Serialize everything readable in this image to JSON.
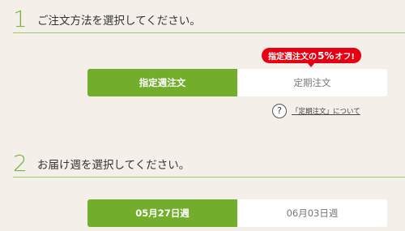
{
  "section1": {
    "number": "1",
    "title": "ご注文方法を選択してください。",
    "options": [
      "指定週注文",
      "定期注文"
    ],
    "promo": {
      "prefix": "指定週注文の",
      "percent": "5%",
      "suffix": "オフ!"
    },
    "help_icon": "?",
    "help_link": "「定期注文」について"
  },
  "section2": {
    "number": "2",
    "title": "お届け週を選択してください。",
    "options": [
      "05月27日週",
      "06月03日週"
    ]
  },
  "colors": {
    "accent_green": "#72ae2c",
    "promo_red": "#e60012",
    "background": "#f4efe9"
  }
}
